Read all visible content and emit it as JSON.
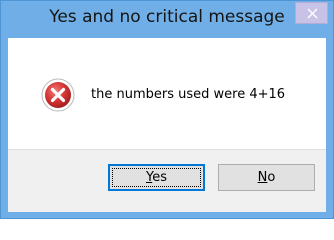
{
  "window": {
    "title": "Yes and no critical message",
    "close_glyph": "✕"
  },
  "message": {
    "icon": "error-icon",
    "text": "the numbers used were 4+16"
  },
  "buttons": {
    "yes": {
      "accel": "Y",
      "rest": "es"
    },
    "no": {
      "accel": "N",
      "rest": "o"
    }
  },
  "colors": {
    "title_bar": "#6faee6",
    "close_button": "#c7c2e6",
    "error_red": "#d23a3a",
    "default_button_border": "#0078d7",
    "button_bar": "#f0f0f0"
  }
}
